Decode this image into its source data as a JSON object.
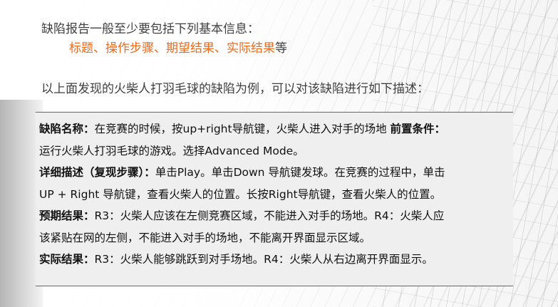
{
  "intro": {
    "line1": "缺陷报告一般至少要包括下列基本信息：",
    "items": "标题、操作步骤、期望结果、实际结果",
    "items_suffix": "等"
  },
  "example_intro": "以上面发现的火柴人打羽毛球的缺陷为例，可以对该缺陷进行如下描述：",
  "defect": {
    "name_label": "缺陷名称：",
    "name_text": "在竞赛的时候，按up+right导航键，火柴人进入对手的场地",
    "precondition_label": "前置条件：",
    "precondition_text": "运行火柴人打羽毛球的游戏。选择Advanced Mode。",
    "steps_label": "详细描述（复现步骤）：",
    "steps_text_1": "单击Play。单击Down 导航键发球。在竞赛的过程中，单击",
    "steps_text_2": "UP + Right 导航键，查看火柴人的位置。长按Right导航键，查看火柴人的位置。",
    "expected_label": "预期结果：",
    "expected_text_1": "R3：火柴人应该在左侧竞赛区域，不能进入对手的场地。R4：火柴人应",
    "expected_text_2": "该紧贴在网的左侧，不能进入对手的场地，不能离开界面显示区域。",
    "actual_label": "实际结果：",
    "actual_text": "R3：火柴人能够跳跃到对手场地。R4：火柴人从右边离开界面显示。"
  }
}
